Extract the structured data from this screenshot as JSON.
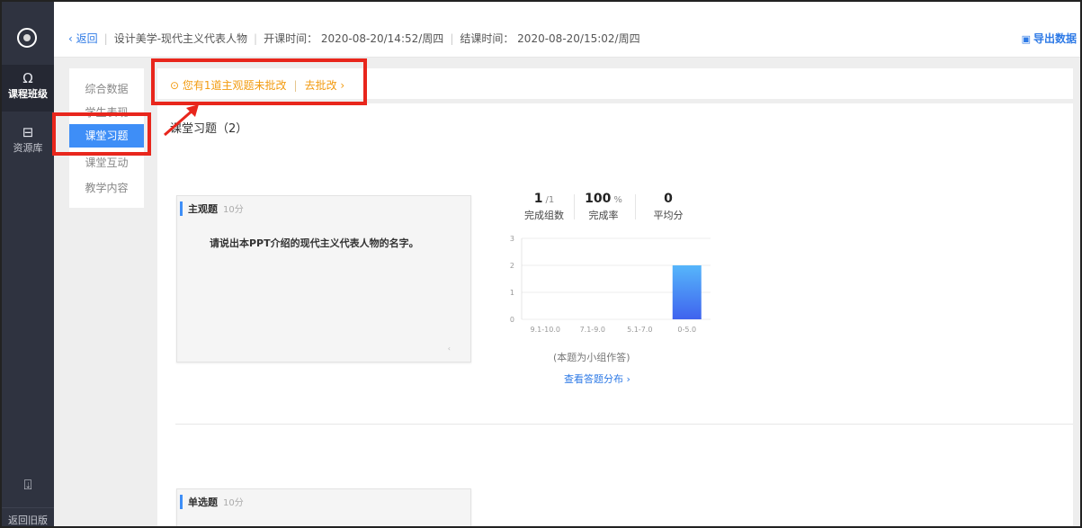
{
  "rail": {
    "course_label": "课程班级",
    "course_icon": "Ω",
    "resource_label": "资源库",
    "resource_icon": "⊟",
    "export_icon": "⍗",
    "back_old_label": "返回旧版"
  },
  "header": {
    "back_label": "返回",
    "course_title": "设计美学-现代主义代表人物",
    "start_time": "开课时间： 2020-08-20/14:52/周四",
    "end_time": "结课时间： 2020-08-20/15:02/周四",
    "export_label": "导出数据"
  },
  "subnav": {
    "items": [
      "综合数据",
      "学生表现",
      "课堂习题",
      "课堂互动",
      "教学内容"
    ],
    "active_index": 2
  },
  "alert": {
    "message": "⊙ 您有1道主观题未批改",
    "action": "去批改 ›"
  },
  "section": {
    "title": "课堂习题（2）"
  },
  "question1": {
    "type": "主观题",
    "points": "10分",
    "text": "请说出本PPT介绍的现代主义代表人物的名字。"
  },
  "stats": {
    "groups_value": "1",
    "groups_total": "/1",
    "groups_label": "完成组数",
    "rate_value": "100",
    "rate_unit": "%",
    "rate_label": "完成率",
    "avg_value": "0",
    "avg_label": "平均分"
  },
  "chart_data": {
    "type": "bar",
    "categories": [
      "9.1-10.0",
      "7.1-9.0",
      "5.1-7.0",
      "0-5.0"
    ],
    "values": [
      0,
      0,
      0,
      2
    ],
    "ylim": [
      0,
      3
    ],
    "yticks": [
      "0",
      "1",
      "2",
      "3"
    ],
    "grid": true,
    "bar_color_top": "#56b6fb",
    "bar_color_bottom": "#3f63ee"
  },
  "chart_note": "(本题为小组作答)",
  "view_distribution": "查看答题分布 ›",
  "question2": {
    "type": "单选题",
    "points": "10分"
  },
  "colors": {
    "accent": "#3e8ef7",
    "alert": "#f29b11",
    "link": "#2e7ae6",
    "annotation": "#e8261c"
  }
}
